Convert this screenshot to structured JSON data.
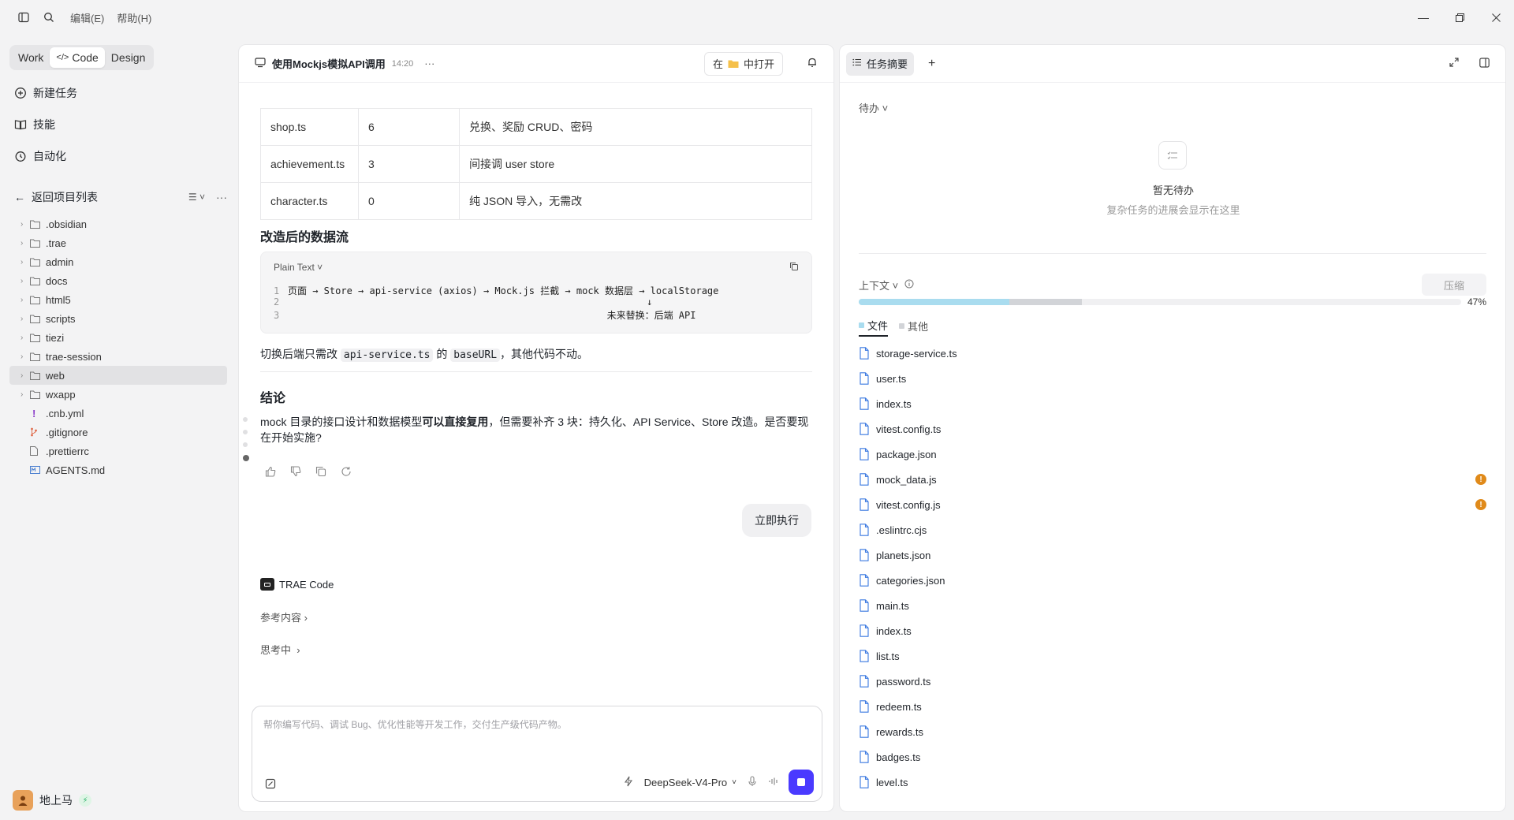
{
  "titlebar": {
    "menu_edit": "编辑(E)",
    "menu_help": "帮助(H)"
  },
  "sidebar": {
    "modes": [
      "Work",
      "Code",
      "Design"
    ],
    "nav": {
      "new_task": "新建任务",
      "skills": "技能",
      "automation": "自动化"
    },
    "back": "返回项目列表",
    "tree": [
      {
        "name": ".obsidian",
        "type": "folder"
      },
      {
        "name": ".trae",
        "type": "folder"
      },
      {
        "name": "admin",
        "type": "folder"
      },
      {
        "name": "docs",
        "type": "folder"
      },
      {
        "name": "html5",
        "type": "folder"
      },
      {
        "name": "scripts",
        "type": "folder"
      },
      {
        "name": "tiezi",
        "type": "folder"
      },
      {
        "name": "trae-session",
        "type": "folder"
      },
      {
        "name": "web",
        "type": "folder"
      },
      {
        "name": "wxapp",
        "type": "folder"
      },
      {
        "name": ".cnb.yml",
        "type": "yml"
      },
      {
        "name": ".gitignore",
        "type": "git"
      },
      {
        "name": ".prettierrc",
        "type": "file"
      },
      {
        "name": "AGENTS.md",
        "type": "md"
      }
    ],
    "user": "地上马"
  },
  "chat": {
    "title": "使用Mockjs模拟API调用",
    "time": "14:20",
    "open_in_prefix": "在",
    "open_in_suffix": "中打开",
    "table": [
      [
        "shop.ts",
        "6",
        "兑换、奖励 CRUD、密码"
      ],
      [
        "achievement.ts",
        "3",
        "间接调 user store"
      ],
      [
        "character.ts",
        "0",
        "纯 JSON 导入，无需改"
      ]
    ],
    "h_flow": "改造后的数据流",
    "code_lang": "Plain Text",
    "code_lines": [
      {
        "n": "1",
        "text": "页面 → Store → api-service (axios) → Mock.js 拦截 → mock 数据层 → localStorage"
      },
      {
        "n": "2",
        "text": "                                                               ↓"
      },
      {
        "n": "3",
        "text": "                                                        未来替换：后端 API"
      }
    ],
    "switch_pre": "切换后端只需改",
    "switch_code1": "api-service.ts",
    "switch_mid": "的",
    "switch_code2": "baseURL",
    "switch_post": "，其他代码不动。",
    "h_conclusion": "结论",
    "conclusion_pre": "mock 目录的接口设计和数据模型",
    "conclusion_bold": "可以直接复用",
    "conclusion_post": "，但需要补齐 3 块：持久化、API Service、Store 改造。是否要现在开始实施?",
    "user_bubble": "立即执行",
    "agent_name": "TRAE Code",
    "reference": "参考内容",
    "thinking": "思考中",
    "composer_placeholder": "帮你编写代码、调试 Bug、优化性能等开发工作，交付生产级代码产物。",
    "model": "DeepSeek-V4-Pro"
  },
  "right": {
    "tab": "任务摘要",
    "todo_label": "待办",
    "empty_title": "暂无待办",
    "empty_sub": "复杂任务的进展会显示在这里",
    "context_label": "上下文",
    "compress": "压缩",
    "usage_percent": "47%",
    "usage": {
      "files_fraction": 0.25,
      "other_fraction": 0.12
    },
    "tabs": [
      "文件",
      "其他"
    ],
    "colors": {
      "files": "#a9dcef",
      "other": "#d2d4d8",
      "warn": "#e08a1a",
      "accent": "#4a3aff"
    },
    "files": [
      {
        "name": "storage-service.ts",
        "warn": false
      },
      {
        "name": "user.ts",
        "warn": false
      },
      {
        "name": "index.ts",
        "warn": false
      },
      {
        "name": "vitest.config.ts",
        "warn": false
      },
      {
        "name": "package.json",
        "warn": false
      },
      {
        "name": "mock_data.js",
        "warn": true
      },
      {
        "name": "vitest.config.js",
        "warn": true
      },
      {
        "name": ".eslintrc.cjs",
        "warn": false
      },
      {
        "name": "planets.json",
        "warn": false
      },
      {
        "name": "categories.json",
        "warn": false
      },
      {
        "name": "main.ts",
        "warn": false
      },
      {
        "name": "index.ts",
        "warn": false
      },
      {
        "name": "list.ts",
        "warn": false
      },
      {
        "name": "password.ts",
        "warn": false
      },
      {
        "name": "redeem.ts",
        "warn": false
      },
      {
        "name": "rewards.ts",
        "warn": false
      },
      {
        "name": "badges.ts",
        "warn": false
      },
      {
        "name": "level.ts",
        "warn": false
      }
    ]
  }
}
